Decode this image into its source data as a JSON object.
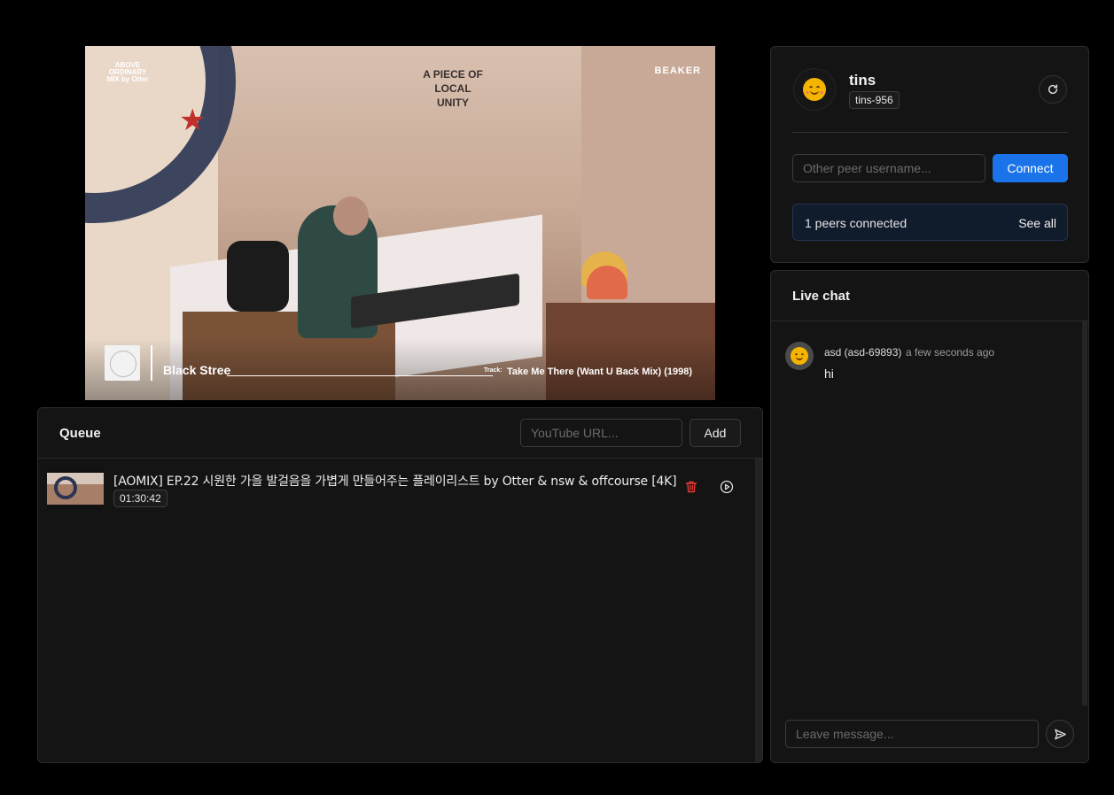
{
  "video": {
    "overlay_logo_left": "ABOVE ORDINARY MIX by Otter",
    "overlay_logo_right": "BEAKER",
    "wall_sign": "A PIECE OF LOCAL UNITY",
    "artist": "Black Stree",
    "track_label": "Track:",
    "track": "Take Me There (Want U Back Mix) (1998)"
  },
  "profile": {
    "username": "tins",
    "tag": "tins-956",
    "peer_input_placeholder": "Other peer username...",
    "connect_label": "Connect",
    "peers_connected": "1 peers connected",
    "see_all_label": "See all"
  },
  "queue": {
    "title": "Queue",
    "url_placeholder": "YouTube URL...",
    "add_label": "Add",
    "items": [
      {
        "title": "[AOMIX] EP.22 시원한 가을 발걸음을 가볍게 만들어주는 플레이리스트 by Otter & nsw & offcourse [4K]",
        "duration": "01:30:42"
      }
    ]
  },
  "chat": {
    "title": "Live chat",
    "messages": [
      {
        "author": "asd (asd-69893)",
        "time": "a few seconds ago",
        "text": "hi"
      }
    ],
    "input_placeholder": "Leave message..."
  },
  "colors": {
    "accent": "#1a73e8",
    "background": "#000000",
    "panel": "#141414",
    "delete": "#e53935"
  }
}
